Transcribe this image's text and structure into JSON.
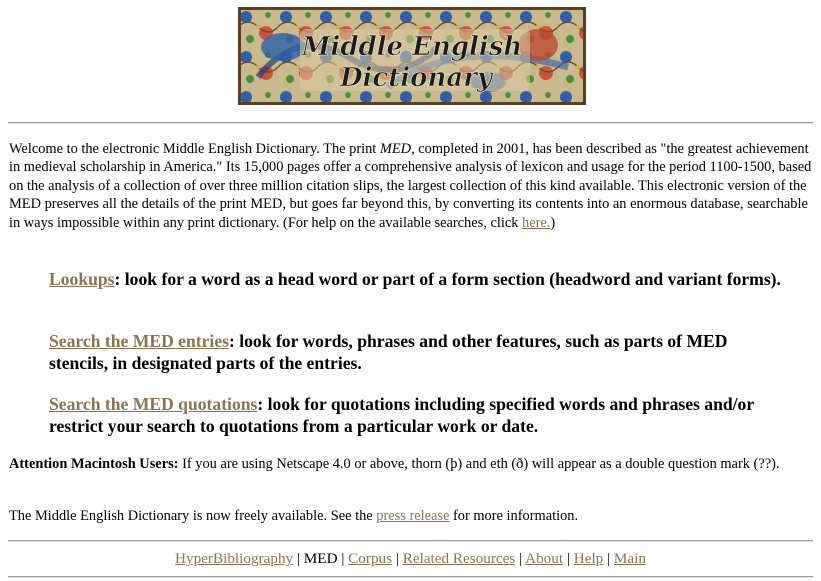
{
  "banner": {
    "line1": "Middle English",
    "line2": "Dictionary"
  },
  "intro": {
    "p1": "Welcome to the electronic Middle English Dictionary. The print ",
    "med_italic": "MED,",
    "p2": " completed in 2001, has been described as \"the greatest achievement in medieval scholarship in America.\" Its 15,000 pages offer a comprehensive analysis of lexicon and usage for the period 1100-1500, based on the analysis of a collection of over three million citation slips, the largest collection of this kind available. This electronic version of the MED preserves all the details of the print MED, but goes far beyond this, by converting its contents into an enormous database, searchable in ways impossible within any print dictionary. (For help on the available searches, click ",
    "here_link": "here.",
    "p3": ")"
  },
  "search_links": [
    {
      "link": "Lookups",
      "desc": ": look for a word as a head word or part of a form section (headword and variant forms)."
    },
    {
      "link": "Search the MED entries",
      "desc": ": look for words, phrases and other features, such as parts of MED stencils, in designated parts of the entries."
    },
    {
      "link": "Search the MED quotations",
      "desc": ": look for quotations including specified words and phrases and/or restrict your search to quotations from a particular work or date."
    }
  ],
  "mac_notice": {
    "label": "Attention Macintosh Users:",
    "text": " If you are using Netscape 4.0 or above, thorn (þ) and eth (ð) will appear as a double question mark (??)."
  },
  "free_notice": {
    "before": "The Middle English Dictionary is now freely available. See the ",
    "link": "press release",
    "after": " for more information."
  },
  "footer": {
    "items": [
      "HyperBibliography",
      "MED",
      "Corpus",
      "Related Resources",
      "About",
      "Help",
      "Main"
    ],
    "separator": "|"
  },
  "colors": {
    "link": "#8b7550",
    "rule": "#9a9a9a"
  }
}
